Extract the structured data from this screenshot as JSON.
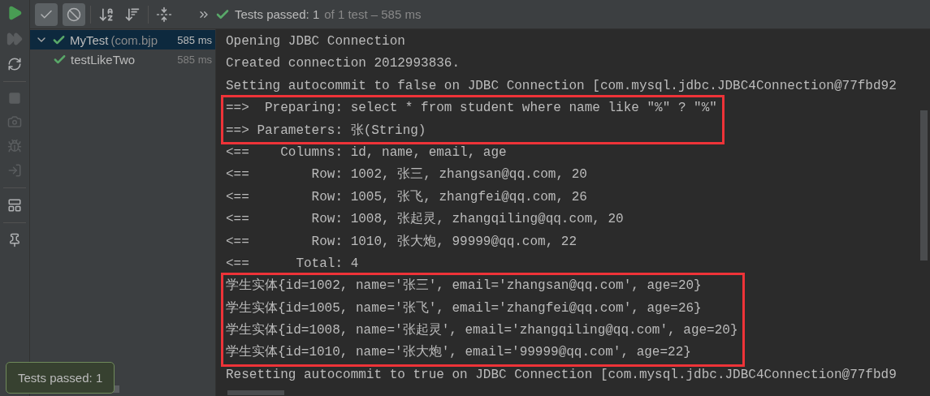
{
  "toolbar": {
    "toggles": [
      {
        "kind": "passed",
        "selected": true
      },
      {
        "kind": "ignored",
        "selected": true
      }
    ],
    "status": {
      "passed": "Tests passed: 1",
      "summary": "of 1 test – 585 ms"
    }
  },
  "tree": [
    {
      "name": "MyTest",
      "detail": "(com.bjp",
      "time": "585 ms",
      "selected": true,
      "expanded": true,
      "children": [
        {
          "name": "testLikeTwo",
          "time": "585 ms",
          "selected": false
        }
      ]
    }
  ],
  "console": [
    {
      "highlighted": false,
      "lines": [
        "Opening JDBC Connection",
        "Created connection 2012993836.",
        "Setting autocommit to false on JDBC Connection [com.mysql.jdbc.JDBC4Connection@77fbd92"
      ]
    },
    {
      "highlighted": true,
      "lines": [
        "==>  Preparing: select * from student where name like \"%\" ? \"%\"",
        "==> Parameters: 张(String)"
      ]
    },
    {
      "highlighted": false,
      "lines": [
        "<==    Columns: id, name, email, age",
        "<==        Row: 1002, 张三, zhangsan@qq.com, 20",
        "<==        Row: 1005, 张飞, zhangfei@qq.com, 26",
        "<==        Row: 1008, 张起灵, zhangqiling@qq.com, 20",
        "<==        Row: 1010, 张大炮, 99999@qq.com, 22",
        "<==      Total: 4"
      ]
    },
    {
      "highlighted": true,
      "lines": [
        "学生实体{id=1002, name='张三', email='zhangsan@qq.com', age=20}",
        "学生实体{id=1005, name='张飞', email='zhangfei@qq.com', age=26}",
        "学生实体{id=1008, name='张起灵', email='zhangqiling@qq.com', age=20}",
        "学生实体{id=1010, name='张大炮', email='99999@qq.com', age=22}"
      ]
    },
    {
      "highlighted": false,
      "lines": [
        "Resetting autocommit to true on JDBC Connection [com.mysql.jdbc.JDBC4Connection@77fbd9"
      ]
    }
  ],
  "tooltip": "Tests passed: 1"
}
